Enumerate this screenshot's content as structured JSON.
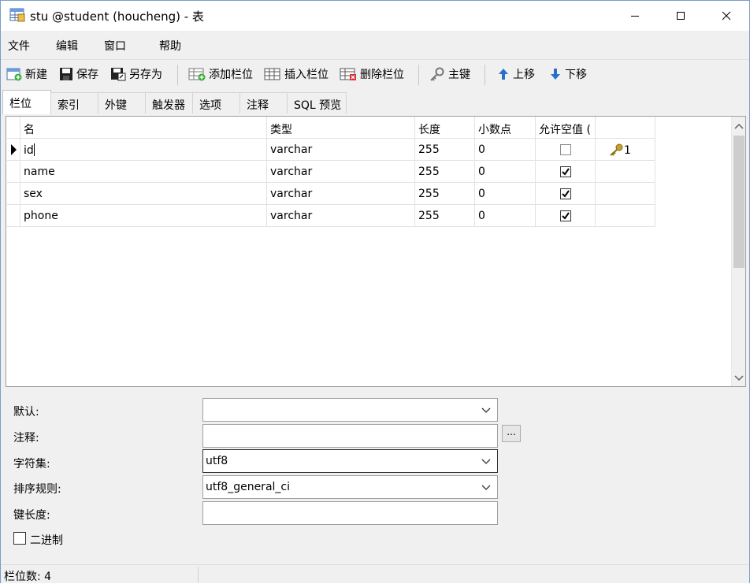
{
  "window": {
    "title": "stu @student (houcheng) - 表"
  },
  "menu": [
    "文件",
    "编辑",
    "窗口",
    "帮助"
  ],
  "toolbar": {
    "new": "新建",
    "save": "保存",
    "save_as": "另存为",
    "add_field": "添加栏位",
    "insert_field": "插入栏位",
    "delete_field": "删除栏位",
    "primary_key": "主键",
    "move_up": "上移",
    "move_down": "下移"
  },
  "tabs": [
    "栏位",
    "索引",
    "外键",
    "触发器",
    "选项",
    "注释",
    "SQL 预览"
  ],
  "grid": {
    "headers": [
      "名",
      "类型",
      "长度",
      "小数点",
      "允许空值 (",
      ""
    ],
    "rows": [
      {
        "name": "id",
        "type": "varchar",
        "length": "255",
        "decimals": "0",
        "nullable": false,
        "key": "1"
      },
      {
        "name": "name",
        "type": "varchar",
        "length": "255",
        "decimals": "0",
        "nullable": true,
        "key": ""
      },
      {
        "name": "sex",
        "type": "varchar",
        "length": "255",
        "decimals": "0",
        "nullable": true,
        "key": ""
      },
      {
        "name": "phone",
        "type": "varchar",
        "length": "255",
        "decimals": "0",
        "nullable": true,
        "key": ""
      }
    ]
  },
  "props": {
    "default_label": "默认:",
    "default_value": "",
    "comment_label": "注释:",
    "comment_value": "",
    "comment_button": "...",
    "charset_label": "字符集:",
    "charset_value": "utf8",
    "collation_label": "排序规则:",
    "collation_value": "utf8_general_ci",
    "key_length_label": "键长度:",
    "key_length_value": "",
    "binary_label": "二进制",
    "binary_checked": false
  },
  "status": {
    "field_count": "栏位数: 4"
  },
  "colors": {
    "accent": "#1e6fd6",
    "border": "#a0a0a0"
  }
}
